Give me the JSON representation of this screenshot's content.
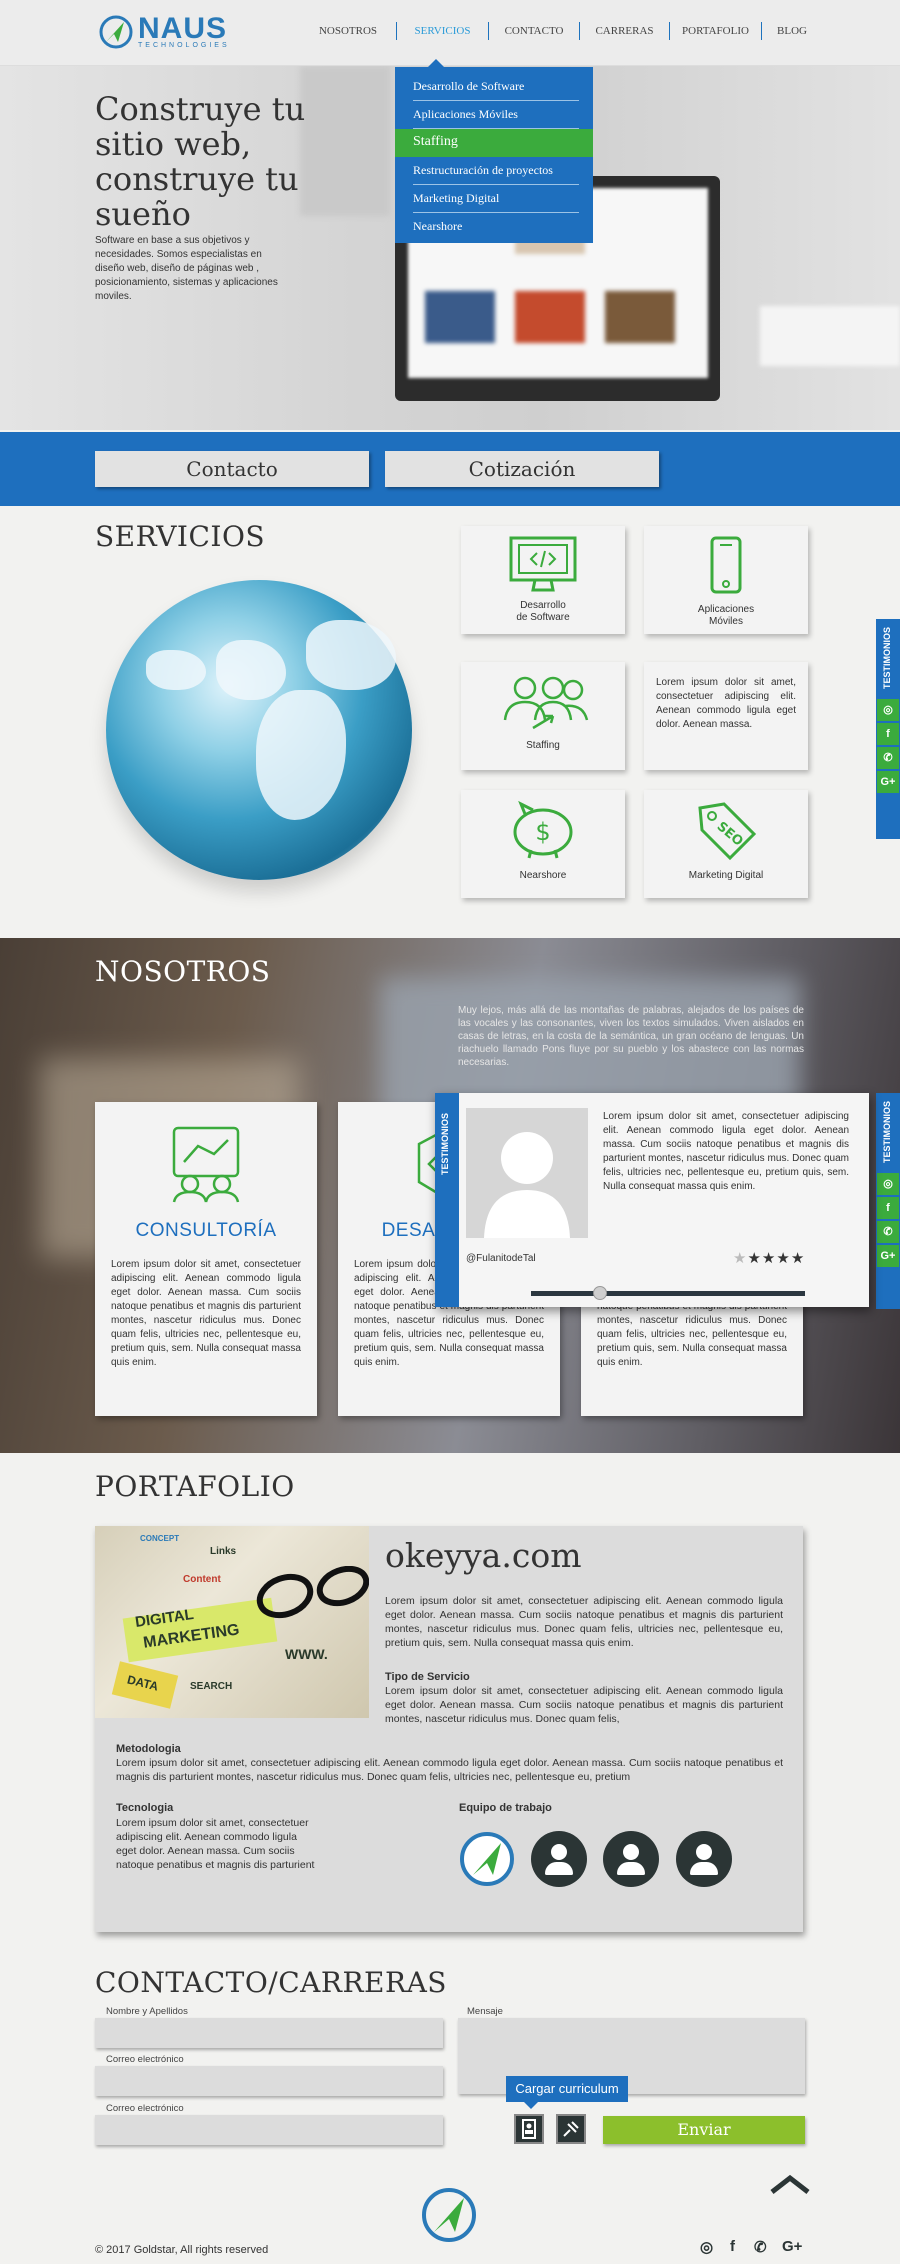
{
  "header": {
    "brand_name": "NAUS",
    "brand_sub": "TECHNOLOGIES",
    "nav": [
      {
        "label": "NOSOTROS"
      },
      {
        "label": "SERVICIOS"
      },
      {
        "label": "CONTACTO"
      },
      {
        "label": "CARRERAS"
      },
      {
        "label": "PORTAFOLIO"
      },
      {
        "label": "BLOG"
      }
    ],
    "active_nav": "SERVICIOS"
  },
  "dropdown": {
    "items": [
      "Desarrollo de Software",
      "Aplicaciones  Móviles",
      "Staffing",
      "Restructuración de proyectos",
      "Marketing Digital",
      "Nearshore"
    ],
    "highlighted": "Staffing"
  },
  "hero": {
    "title": "Construye tu sitio web, construye tu sueño",
    "text": "Software en base a sus objetivos y necesidades.  Somos especialistas en diseño web, diseño de páginas web , posicionamiento, sistemas y aplicaciones moviles."
  },
  "cta": {
    "contacto": "Contacto",
    "cotizacion": "Cotización"
  },
  "servicios": {
    "title": "SERVICIOS",
    "cards": [
      {
        "label": "Desarrollo\nde Software",
        "icon": "monitor-code-icon"
      },
      {
        "label": "Aplicaciones\nMóviles",
        "icon": "smartphone-icon"
      },
      {
        "label": "Staffing",
        "icon": "people-group-icon"
      },
      {
        "text": "Lorem ipsum dolor sit amet, consectetuer adipiscing elit. Aenean commodo ligula eget dolor. Aenean massa."
      },
      {
        "label": "Nearshore",
        "icon": "piggy-bank-icon"
      },
      {
        "label": "Marketing Digital",
        "icon": "seo-tag-icon"
      }
    ]
  },
  "side_widget": {
    "label": "TESTIMONIOS",
    "icons": [
      "instagram-icon",
      "facebook-icon",
      "whatsapp-icon",
      "google-plus-icon"
    ]
  },
  "nosotros": {
    "title": "NOSOTROS",
    "text": "Muy lejos, más allá de las montañas de palabras, alejados de los países de las vocales y las consonantes, viven los textos simulados. Viven aislados en casas de letras, en la costa de la semántica, un gran océano de lenguas. Un riachuelo llamado Pons fluye por su pueblo y los abastece con las normas necesarias.",
    "cards": [
      {
        "title": "CONSULTORÍA",
        "text": "Lorem ipsum dolor sit amet, consectetuer adipiscing elit. Aenean commodo ligula eget dolor. Aenean massa. Cum sociis natoque penatibus et magnis dis parturient montes, nascetur ridiculus mus. Donec quam felis, ultricies nec, pellentesque eu, pretium quis, sem. Nulla consequat massa quis enim."
      },
      {
        "title": "DESARROLLO",
        "text": "Lorem ipsum dolor sit amet, consectetuer adipiscing elit. Aenean commodo ligula eget dolor. Aenean massa. Cum sociis natoque penatibus et magnis dis parturient montes, nascetur ridiculus mus. Donec quam felis, ultricies nec, pellentesque eu, pretium quis, sem. Nulla consequat massa quis enim."
      },
      {
        "title": "",
        "text": "Lorem ipsum dolor sit amet, consectetuer adipiscing elit. Aenean commodo ligula eget dolor. Aenean massa. Cum sociis natoque penatibus et magnis dis parturient montes, nascetur ridiculus mus. Donec quam felis, ultricies nec, pellentesque eu, pretium quis, sem. Nulla consequat massa quis enim."
      }
    ]
  },
  "testimonial": {
    "tab": "TESTIMONIOS",
    "quote": "Lorem ipsum dolor sit amet, consectetuer adipiscing elit. Aenean commodo ligula eget dolor. Aenean massa. Cum sociis natoque penatibus et magnis dis parturient montes, nascetur ridiculus mus. Donec quam felis, ultricies nec, pellentesque eu, pretium quis, sem. Nulla consequat massa quis enim.",
    "author": "@FulanitodeTal",
    "rating": 4,
    "rating_max": 5,
    "slider_progress": 0.25
  },
  "portafolio": {
    "title": "PORTAFOLIO",
    "project": "okeyya.com",
    "intro": "Lorem ipsum dolor sit amet, consectetuer adipiscing elit. Aenean commodo ligula eget dolor. Aenean massa. Cum sociis natoque penatibus et magnis dis parturient montes, nascetur ridiculus mus. Donec quam felis, ultricies nec, pellentesque eu, pretium quis, sem. Nulla consequat massa quis enim.",
    "tipo_title": "Tipo de Servicio",
    "tipo_text": "Lorem ipsum dolor sit amet, consectetuer adipiscing elit. Aenean commodo ligula eget dolor. Aenean massa. Cum sociis natoque penatibus et magnis dis parturient montes, nascetur ridiculus mus. Donec quam felis,",
    "metodologia_title": "Metodologia",
    "metodologia_text": "Lorem ipsum dolor sit amet, consectetuer adipiscing elit. Aenean commodo ligula eget dolor. Aenean massa. Cum sociis natoque penatibus et magnis dis parturient montes, nascetur ridiculus mus. Donec quam felis, ultricies nec, pellentesque eu, pretium",
    "tecnologia_title": "Tecnologia",
    "tecnologia_text": "Lorem ipsum dolor sit amet, consectetuer adipiscing elit. Aenean commodo ligula eget dolor. Aenean massa. Cum sociis natoque penatibus et magnis dis parturient",
    "equipo_title": "Equipo de trabajo",
    "image_words": [
      "DIGITAL",
      "MARKETING",
      "WWW.",
      "SEARCH",
      "Content",
      "Links",
      "DATA",
      "CONCEPT"
    ]
  },
  "contacto": {
    "title": "CONTACTO/CARRERAS",
    "name_label": "Nombre y Apellidos",
    "email_label": "Correo electrónico",
    "email2_label": "Correo electrónico",
    "message_label": "Mensaje",
    "cv_button": "Cargar curriculum",
    "send_button": "Enviar"
  },
  "footer": {
    "copyright": "© 2017 Goldstar, All rights reserved",
    "social": [
      "instagram-icon",
      "facebook-icon",
      "whatsapp-icon",
      "google-plus-icon"
    ],
    "social_glyphs": [
      "◎",
      "f",
      "✆",
      "G+"
    ]
  },
  "colors": {
    "blue": "#1e6fbe",
    "green": "#3bab3d",
    "send_green": "#8cbf2c",
    "dark": "#2b3535"
  }
}
